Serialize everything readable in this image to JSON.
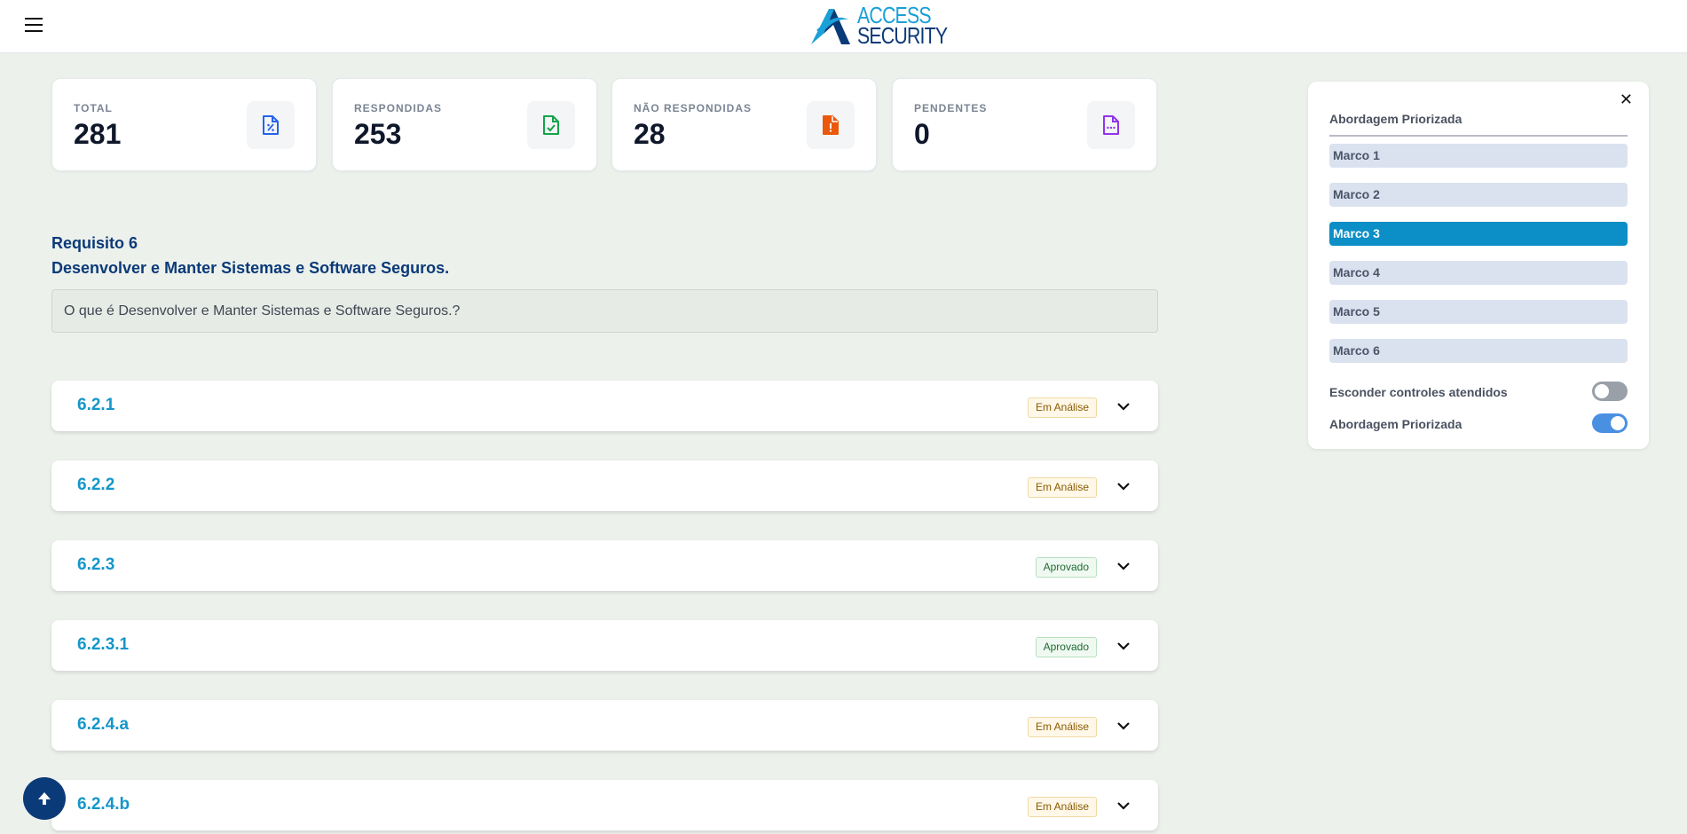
{
  "header": {
    "logo_line1": "ACCESS",
    "logo_line2": "SECURITY",
    "menu_icon": "hamburger-icon"
  },
  "stats": [
    {
      "label": "TOTAL",
      "value": "281",
      "icon": "file-percent-icon",
      "color": "#2563eb"
    },
    {
      "label": "RESPONDIDAS",
      "value": "253",
      "icon": "file-check-icon",
      "color": "#16a34a"
    },
    {
      "label": "NÃO RESPONDIDAS",
      "value": "28",
      "icon": "file-alert-icon",
      "color": "#ea580c"
    },
    {
      "label": "PENDENTES",
      "value": "0",
      "icon": "file-dots-icon",
      "color": "#9333ea"
    }
  ],
  "requirement": {
    "number": "Requisito 6",
    "title": "Desenvolver e Manter Sistemas e Software Seguros.",
    "question": "O que é Desenvolver e Manter Sistemas e Software Seguros.?"
  },
  "items": [
    {
      "code": "6.2.1",
      "status": "Em Análise"
    },
    {
      "code": "6.2.2",
      "status": "Em Análise"
    },
    {
      "code": "6.2.3",
      "status": "Aprovado"
    },
    {
      "code": "6.2.3.1",
      "status": "Aprovado"
    },
    {
      "code": "6.2.4.a",
      "status": "Em Análise"
    },
    {
      "code": "6.2.4.b",
      "status": "Em Análise"
    }
  ],
  "side_panel": {
    "heading": "Abordagem Priorizada",
    "marcos": [
      "Marco 1",
      "Marco 2",
      "Marco 3",
      "Marco 4",
      "Marco 5",
      "Marco 6"
    ],
    "active_marco": "Marco 3",
    "toggles": [
      {
        "label": "Esconder controles atendidos",
        "on": false
      },
      {
        "label": "Abordagem Priorizada",
        "on": true
      }
    ]
  },
  "colors": {
    "brand_dark": "#0b3a78",
    "brand_light": "#1596c9",
    "active_marco": "#0b8fc6"
  }
}
